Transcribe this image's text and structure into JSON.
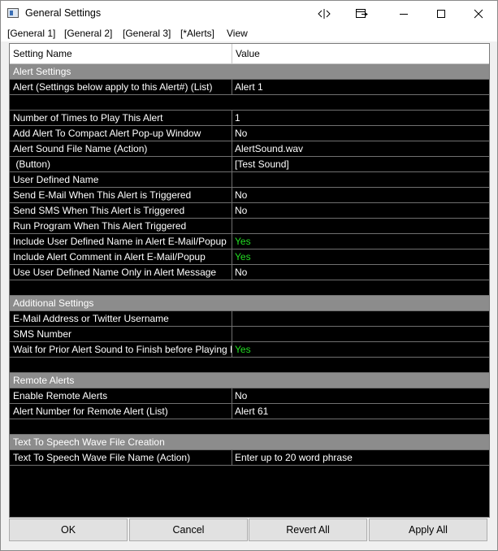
{
  "window": {
    "title": "General Settings"
  },
  "titlebar_icons": [
    "split-icon",
    "dock-icon",
    "minimize-icon",
    "maximize-icon",
    "close-icon"
  ],
  "menu": [
    {
      "label": "[General 1]"
    },
    {
      "label": "[General 2]"
    },
    {
      "label": "[General 3]"
    },
    {
      "label": "[*Alerts]"
    },
    {
      "label": "View"
    }
  ],
  "grid": {
    "headers": {
      "name": "Setting Name",
      "value": "Value"
    },
    "colors": {
      "yes": "#22dd22",
      "section": "#8c8c8c",
      "background": "#000000"
    },
    "rows": [
      {
        "type": "section",
        "name": "Alert Settings"
      },
      {
        "type": "row",
        "name": "Alert (Settings below apply to this Alert#) (List)",
        "value": "Alert 1"
      },
      {
        "type": "blank"
      },
      {
        "type": "row",
        "name": "Number of Times to Play This Alert",
        "value": "1"
      },
      {
        "type": "row",
        "name": "Add Alert To Compact Alert Pop-up Window",
        "value": "No"
      },
      {
        "type": "row",
        "name": "Alert Sound File Name (Action)",
        "value": "AlertSound.wav"
      },
      {
        "type": "row",
        "name": " (Button)",
        "value": "[Test Sound]"
      },
      {
        "type": "row",
        "name": "User Defined Name",
        "value": ""
      },
      {
        "type": "row",
        "name": "Send E-Mail When This Alert is Triggered",
        "value": "No"
      },
      {
        "type": "row",
        "name": "Send SMS When This Alert is Triggered",
        "value": "No"
      },
      {
        "type": "row",
        "name": "Run Program When This Alert Triggered",
        "value": ""
      },
      {
        "type": "row",
        "name": "Include User Defined Name in Alert E-Mail/Popup",
        "value": "Yes",
        "green": true
      },
      {
        "type": "row",
        "name": "Include Alert Comment in Alert E-Mail/Popup",
        "value": "Yes",
        "green": true
      },
      {
        "type": "row",
        "name": "Use User Defined Name Only in Alert Message",
        "value": "No"
      },
      {
        "type": "blank"
      },
      {
        "type": "section",
        "name": "Additional Settings"
      },
      {
        "type": "row",
        "name": "E-Mail Address or Twitter Username",
        "value": ""
      },
      {
        "type": "row",
        "name": "SMS Number",
        "value": ""
      },
      {
        "type": "row",
        "name": "Wait for Prior Alert Sound to Finish before Playing N",
        "value": "Yes",
        "green": true
      },
      {
        "type": "blank"
      },
      {
        "type": "section",
        "name": "Remote Alerts"
      },
      {
        "type": "row",
        "name": "Enable Remote Alerts",
        "value": "No"
      },
      {
        "type": "row",
        "name": "Alert Number for Remote Alert (List)",
        "value": "Alert 61"
      },
      {
        "type": "blank"
      },
      {
        "type": "section",
        "name": "Text To Speech Wave File Creation"
      },
      {
        "type": "row",
        "name": "Text To Speech Wave File Name (Action)",
        "value": "Enter up to 20 word phrase"
      }
    ]
  },
  "buttons": {
    "ok": "OK",
    "cancel": "Cancel",
    "revert": "Revert All",
    "apply": "Apply All"
  }
}
